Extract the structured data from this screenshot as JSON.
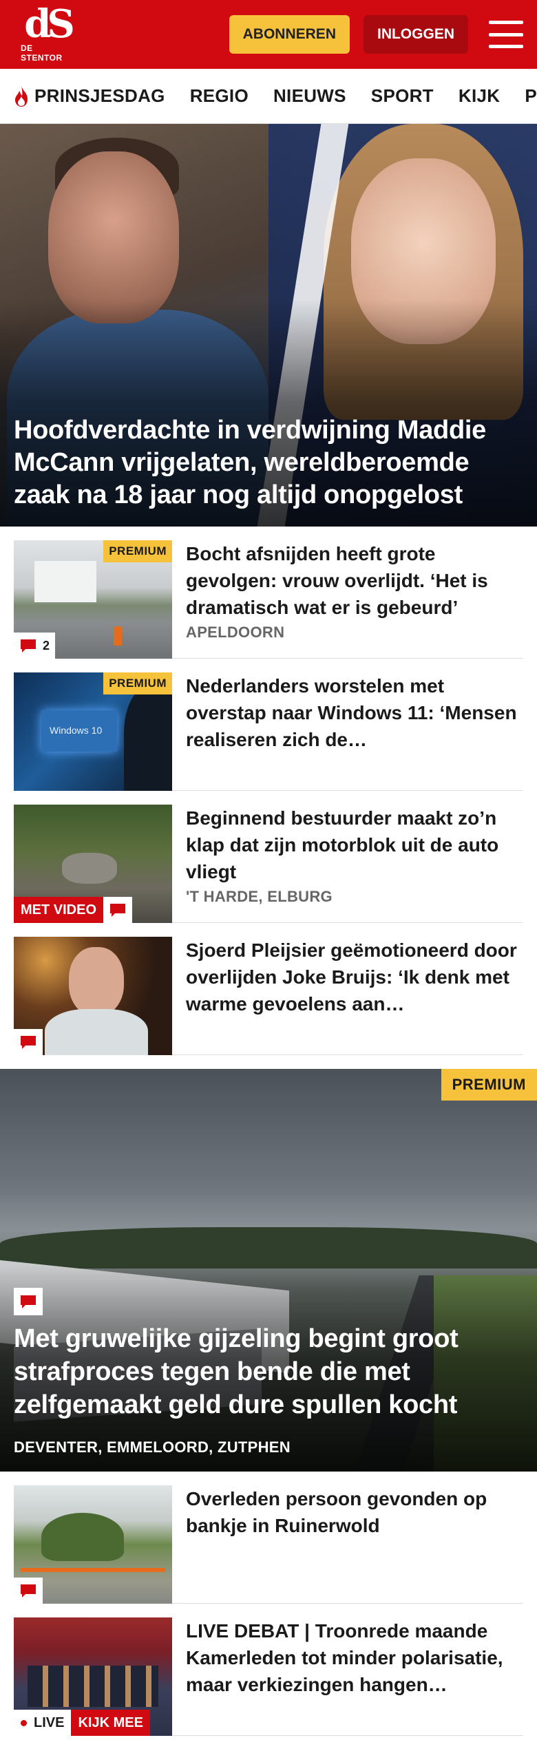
{
  "header": {
    "logo_mark": "dS",
    "logo_sub": "DE STENTOR",
    "subscribe_label": "ABONNEREN",
    "login_label": "INLOGGEN",
    "menu_icon": "hamburger-menu-icon"
  },
  "nav": {
    "items": [
      {
        "label": "PRINSJESDAG",
        "icon": "flame-icon"
      },
      {
        "label": "REGIO"
      },
      {
        "label": "NIEUWS"
      },
      {
        "label": "SPORT"
      },
      {
        "label": "KIJK"
      },
      {
        "label": "PODCA"
      }
    ]
  },
  "hero": {
    "title": "Hoofdverdachte in verdwijning Maddie McCann vrijgelaten, wereldbe­roemde zaak na 18 jaar nog altijd onopgelost"
  },
  "articles": [
    {
      "title": "Bocht afsnijden heeft grote gevolgen: vrouw overlijdt. ‘Het is dramatisch wat er is gebeurd’",
      "location": "APELDOORN",
      "badge": "PREMIUM",
      "comments": "2"
    },
    {
      "title": "Nederlanders worstelen met overstap naar Windows 11: ‘Mensen realiseren zich de…",
      "badge": "PREMIUM",
      "thumb_text": "Windows 10"
    },
    {
      "title": "Beginnend bestuurder maakt zo’n klap dat zijn motorblok uit de auto vliegt",
      "location": "'T HARDE, ELBURG",
      "video_label": "MET VIDEO"
    },
    {
      "title": "Sjoerd Pleijsier geëmotioneerd door overlijden Joke Bruijs: ‘Ik denk met warme gevoelens aan…"
    }
  ],
  "feature": {
    "badge": "PREMIUM",
    "title": "Met gruwelijke gijzeling begint groot strafproces tegen bende die met zelfgemaakt geld dure spullen kocht",
    "location": "DEVENTER, EMMELOORD, ZUTPHEN"
  },
  "articles2": [
    {
      "title": "Overleden persoon gevonden op bankje in Ruinerwold"
    },
    {
      "title": "LIVE DEBAT | Troonrede maande Kamerleden tot minder polarisa­tie, maar verkiezingen hangen…",
      "live_label": "LIVE",
      "watch_label": "KIJK MEE"
    }
  ],
  "colors": {
    "brand_red": "#d10a11",
    "premium_yellow": "#f7c23b",
    "login_dark_red": "#a80a10"
  }
}
